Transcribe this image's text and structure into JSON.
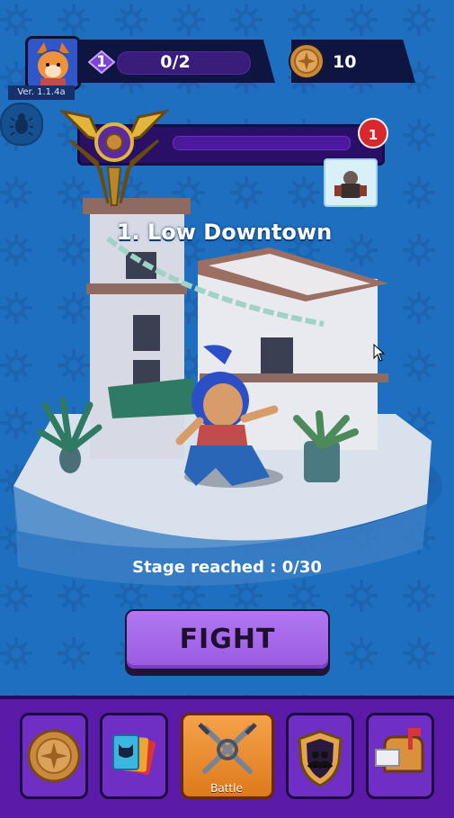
{
  "header": {
    "version": "Ver. 1.1.4a",
    "level": "1",
    "xp": "0/2",
    "coins": "10"
  },
  "stage": {
    "name": "1. Low Downtown",
    "notification_count": "1",
    "reached_text": "Stage reached : 0/30"
  },
  "actions": {
    "fight_label": "FIGHT"
  },
  "nav": {
    "items": [
      {
        "icon": "coin-medallion-icon"
      },
      {
        "icon": "cards-icon"
      },
      {
        "icon": "crossed-weapons-icon",
        "label": "Battle"
      },
      {
        "icon": "guild-shield-icon"
      },
      {
        "icon": "mailbox-icon"
      }
    ]
  },
  "colors": {
    "background": "#1e6fc0",
    "nav": "#5b1aa7",
    "fight": "#a566e8",
    "active_tab": "#f09a3e",
    "badge": "#d8282e"
  }
}
